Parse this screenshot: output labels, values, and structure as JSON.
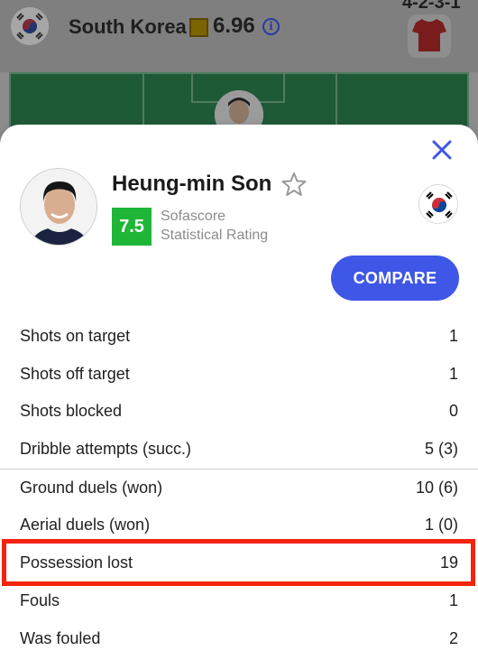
{
  "header": {
    "team": "South Korea",
    "team_rating": "6.96",
    "info_icon": "info-icon",
    "formation": "4-2-3-1"
  },
  "player": {
    "name": "Heung-min Son",
    "rating": "7.5",
    "rating_label_line1": "Sofascore",
    "rating_label_line2": "Statistical Rating",
    "compare_label": "COMPARE"
  },
  "stats": [
    {
      "label": "Shots on target",
      "value": "1"
    },
    {
      "label": "Shots off target",
      "value": "1"
    },
    {
      "label": "Shots blocked",
      "value": "0"
    },
    {
      "label": "Dribble attempts (succ.)",
      "value": "5 (3)"
    },
    {
      "label": "Ground duels (won)",
      "value": "10 (6)"
    },
    {
      "label": "Aerial duels (won)",
      "value": "1 (0)"
    },
    {
      "label": "Possession lost",
      "value": "19"
    },
    {
      "label": "Fouls",
      "value": "1"
    },
    {
      "label": "Was fouled",
      "value": "2"
    }
  ],
  "colors": {
    "accent": "#3f57e6",
    "rating_green": "#1fb638",
    "highlight_red": "#f5230b"
  }
}
